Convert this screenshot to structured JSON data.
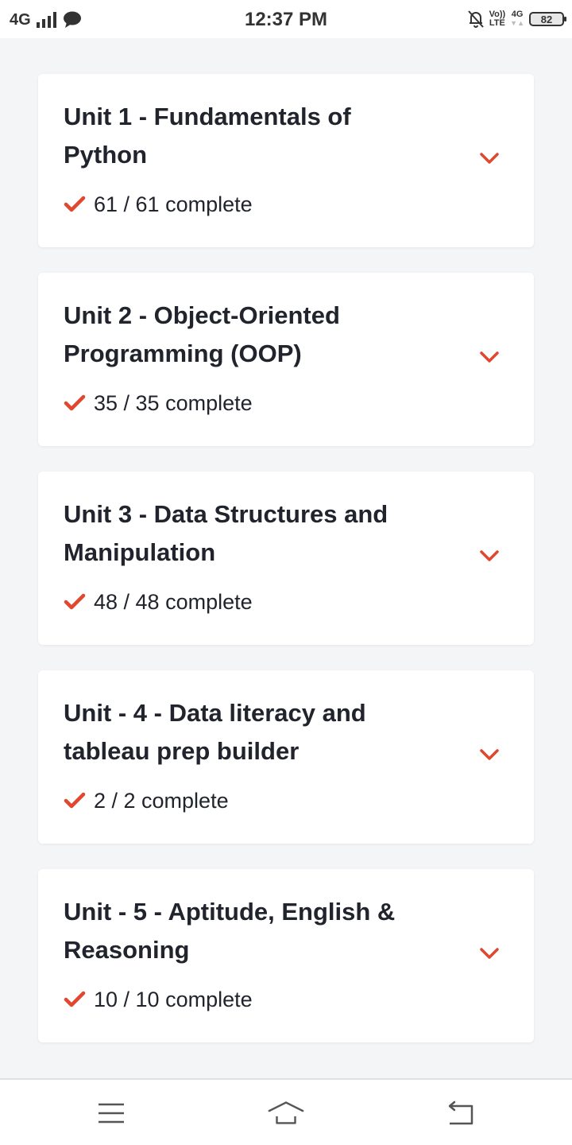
{
  "status_bar": {
    "network": "4G",
    "time": "12:37 PM",
    "volte_top": "Vo))",
    "volte_bottom": "LTE",
    "network_right": "4G",
    "battery": "82"
  },
  "colors": {
    "accent": "#e0472e",
    "text": "#21242c",
    "background": "#f4f5f7"
  },
  "units": [
    {
      "title": "Unit 1 - Fundamentals of Python",
      "progress": "61 / 61 complete"
    },
    {
      "title": "Unit 2 - Object-Oriented Programming (OOP)",
      "progress": "35 / 35 complete"
    },
    {
      "title": "Unit 3 - Data Structures and Manipulation",
      "progress": "48 / 48 complete"
    },
    {
      "title": "Unit - 4 - Data literacy and tableau prep builder",
      "progress": "2 / 2 complete"
    },
    {
      "title": "Unit - 5 - Aptitude, English & Reasoning",
      "progress": "10 / 10 complete"
    }
  ],
  "icons": {
    "unit_status": "check-icon",
    "unit_expand": "chevron-down-icon",
    "nav": [
      "menu-icon",
      "home-icon",
      "back-icon"
    ]
  }
}
